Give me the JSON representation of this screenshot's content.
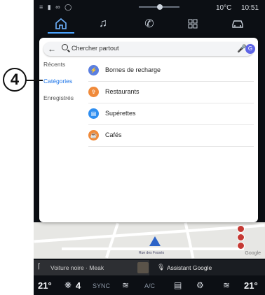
{
  "annotation": {
    "number": "4"
  },
  "status": {
    "temperature": "10°C",
    "time": "10:51"
  },
  "nav_icons": [
    "home-icon",
    "music-icon",
    "phone-icon",
    "apps-icon",
    "car-icon"
  ],
  "search": {
    "placeholder": "Chercher partout",
    "avatar_letter": "G"
  },
  "sidebar": {
    "items": [
      {
        "label": "Récents"
      },
      {
        "label": "Catégories"
      },
      {
        "label": "Enregistrés"
      }
    ]
  },
  "categories": [
    {
      "label": "Bornes de recharge",
      "color": "#5b7fe0",
      "icon": "ev-charger-icon"
    },
    {
      "label": "Restaurants",
      "color": "#f08a3a",
      "icon": "restaurant-icon"
    },
    {
      "label": "Supérettes",
      "color": "#2f8ef0",
      "icon": "shopping-cart-icon"
    },
    {
      "label": "Cafés",
      "color": "#f08a3a",
      "icon": "coffee-icon"
    }
  ],
  "map": {
    "street_label": "Rue des Fossés"
  },
  "media": {
    "track_text": "Voiture noire · Meak",
    "assistant_label": "Assistant Google"
  },
  "climate": {
    "left_temp": "21°",
    "fan_level": "4",
    "sync_label": "SYNC",
    "ac_label": "A/C",
    "right_temp": "21°"
  },
  "colors": {
    "accent": "#1a73e8",
    "nav_active": "#6fb3ff",
    "background": "#0c0f14"
  }
}
